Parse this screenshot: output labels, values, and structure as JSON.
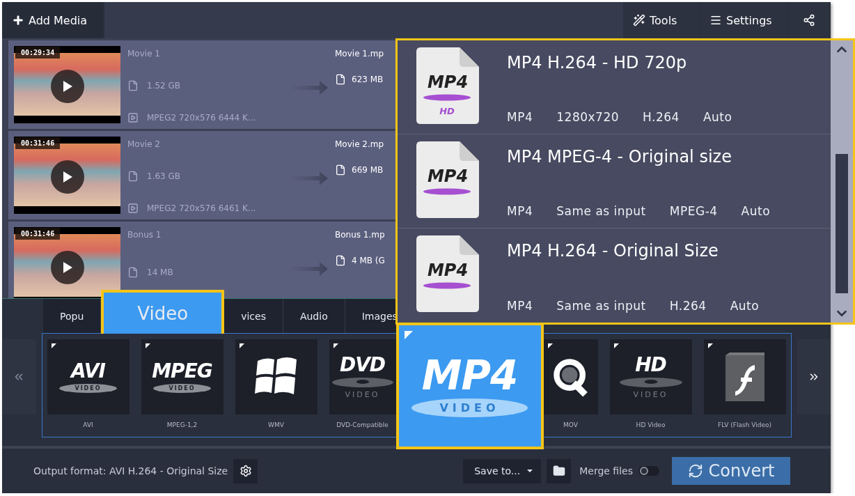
{
  "toolbar": {
    "add_media": "Add Media",
    "tools": "Tools",
    "settings": "Settings"
  },
  "files": [
    {
      "duration": "00:29:34",
      "name": "Movie 1",
      "size": "1.52 GB",
      "codec": "MPEG2 720x576 6444 K...",
      "output_name": "Movie 1.mp",
      "output_size": "623 MB"
    },
    {
      "duration": "00:31:46",
      "name": "Movie 2",
      "size": "1.63 GB",
      "codec": "MPEG2 720x576 6461 K...",
      "output_name": "Movie 2.mp",
      "output_size": "669 MB"
    },
    {
      "duration": "00:31:46",
      "name": "Bonus 1",
      "size": "14 MB",
      "output_name": "Bonus 1.mp",
      "output_size": "4 MB (G"
    }
  ],
  "format_tabs": [
    {
      "label": "Popu",
      "selected": false
    },
    {
      "label": "Video",
      "selected": true
    },
    {
      "label": "vices",
      "selected": false
    },
    {
      "label": "Audio",
      "selected": false
    },
    {
      "label": "Images",
      "selected": false
    }
  ],
  "formats": [
    {
      "kind": "logo",
      "logo": "AVI",
      "sub": "VIDEO",
      "label": "AVI",
      "selected": false
    },
    {
      "kind": "logo",
      "logo": "MPEG",
      "sub": "VIDEO",
      "label": "MPEG-1,2",
      "selected": false
    },
    {
      "kind": "windows",
      "label": "WMV",
      "selected": false
    },
    {
      "kind": "disc",
      "logo": "DVD",
      "sub": "VIDEO",
      "label": "DVD-Compatible",
      "selected": false
    },
    {
      "kind": "logo",
      "logo": "MP4",
      "sub": "VIDEO",
      "selected": true
    },
    {
      "kind": "q",
      "label": "MOV",
      "selected": false
    },
    {
      "kind": "disc",
      "logo": "HD",
      "sub": "VIDEO",
      "label": "HD Video",
      "selected": false
    },
    {
      "kind": "flash",
      "label": "FLV (Flash Video)",
      "selected": false
    }
  ],
  "presets": [
    {
      "title": "MP4 H.264 - HD 720p",
      "icon": "MP4",
      "badge": "HD",
      "specs": [
        "MP4",
        "1280x720",
        "H.264",
        "Auto"
      ]
    },
    {
      "title": "MP4 MPEG-4 - Original size",
      "icon": "MP4",
      "specs": [
        "MP4",
        "Same as input",
        "MPEG-4",
        "Auto"
      ]
    },
    {
      "title": "MP4 H.264 - Original Size",
      "icon": "MP4",
      "specs": [
        "MP4",
        "Same as input",
        "H.264",
        "Auto"
      ]
    }
  ],
  "bottom": {
    "output_format": "Output format: AVI H.264 - Original Size",
    "save_to": "Save to...",
    "merge_label": "Merge files",
    "merge_on": false,
    "convert": "Convert"
  }
}
